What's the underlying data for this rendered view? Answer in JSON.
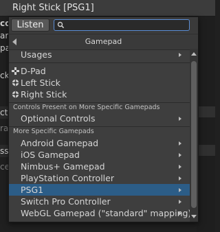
{
  "window": {
    "title": "Right Stick [PSG1]"
  },
  "background_fragments": [
    "co",
    "ard",
    "pad",
    "ck",
    "cti",
    "ra",
    "sso",
    "ce"
  ],
  "popup": {
    "listen_label": "Listen",
    "search": {
      "value": "",
      "placeholder": ""
    },
    "header_title": "Gamepad",
    "items": {
      "usages": "Usages",
      "dpad": "D-Pad",
      "left_stick": "Left Stick",
      "right_stick": "Right Stick"
    },
    "section_controls_present": "Controls Present on More Specific Gamepads",
    "optional_controls": "Optional Controls",
    "section_specific": "More Specific Gamepads",
    "gamepads": [
      {
        "label": "Android Gamepad"
      },
      {
        "label": "iOS Gamepad"
      },
      {
        "label": "Nimbus+ Gamepad"
      },
      {
        "label": "PlayStation Controller"
      },
      {
        "label": "PSG1",
        "selected": true
      },
      {
        "label": "Switch Pro Controller"
      },
      {
        "label": "WebGL Gamepad (\"standard\" mapping)"
      }
    ]
  },
  "colors": {
    "selection": "#2c5d87",
    "search_border": "#5b8ed6",
    "popup_bg": "#3e3e3e"
  }
}
